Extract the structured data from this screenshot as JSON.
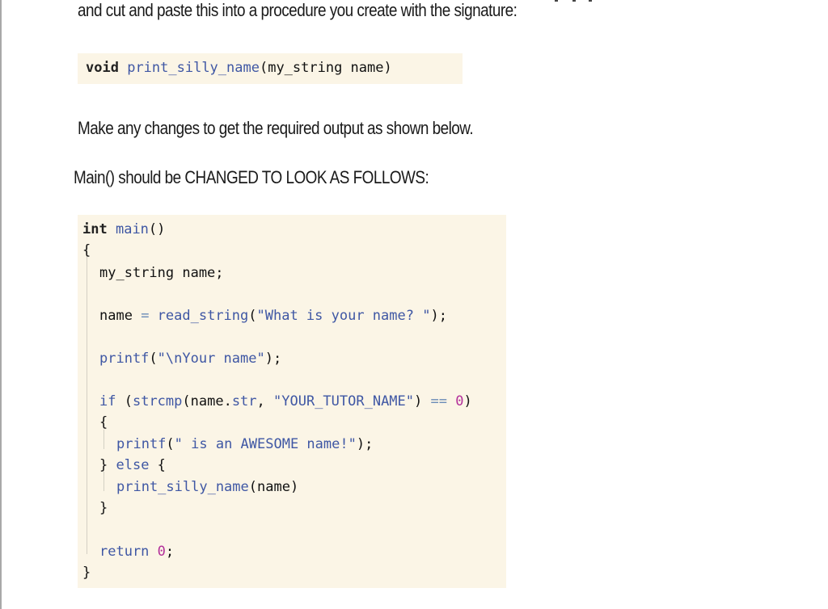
{
  "intro_text": "and cut and paste this into a procedure you create with the signature:",
  "signature": {
    "return_type": "void",
    "func_name": "print_silly_name",
    "params": "(my_string name)"
  },
  "instruction_text": "Make any changes to get the required output as shown below.",
  "main_instruction_text": "Main() should be CHANGED TO LOOK AS FOLLOWS:",
  "code": {
    "l1_kw": "int",
    "l1_fn": "main",
    "l1_rest": "()",
    "l2": "{",
    "l3": "my_string name;",
    "l4_a": "name ",
    "l4_eq": "=",
    "l4_fn": " read_string",
    "l4_p1": "(",
    "l4_str": "\"What is your name? \"",
    "l4_end": ");",
    "l5_fn": "printf",
    "l5_p1": "(",
    "l5_str": "\"\\nYour name\"",
    "l5_end": ");",
    "l6_kw": "if",
    "l6_a": " (",
    "l6_fn": "strcmp",
    "l6_b": "(name.",
    "l6_member": "str",
    "l6_c": ", ",
    "l6_str": "\"YOUR_TUTOR_NAME\"",
    "l6_d": ") ",
    "l6_eq": "==",
    "l6_sp": " ",
    "l6_num": "0",
    "l6_e": ")",
    "l7": "{",
    "l8_fn": "printf",
    "l8_p1": "(",
    "l8_str": "\" is an AWESOME name!\"",
    "l8_end": ");",
    "l9_a": "} ",
    "l9_kw": "else",
    "l9_b": " {",
    "l10_fn": "print_silly_name",
    "l10_rest": "(name)",
    "l11": "}",
    "l12_kw": "return",
    "l12_sp": " ",
    "l12_num": "0",
    "l12_end": ";",
    "l13": "}"
  }
}
